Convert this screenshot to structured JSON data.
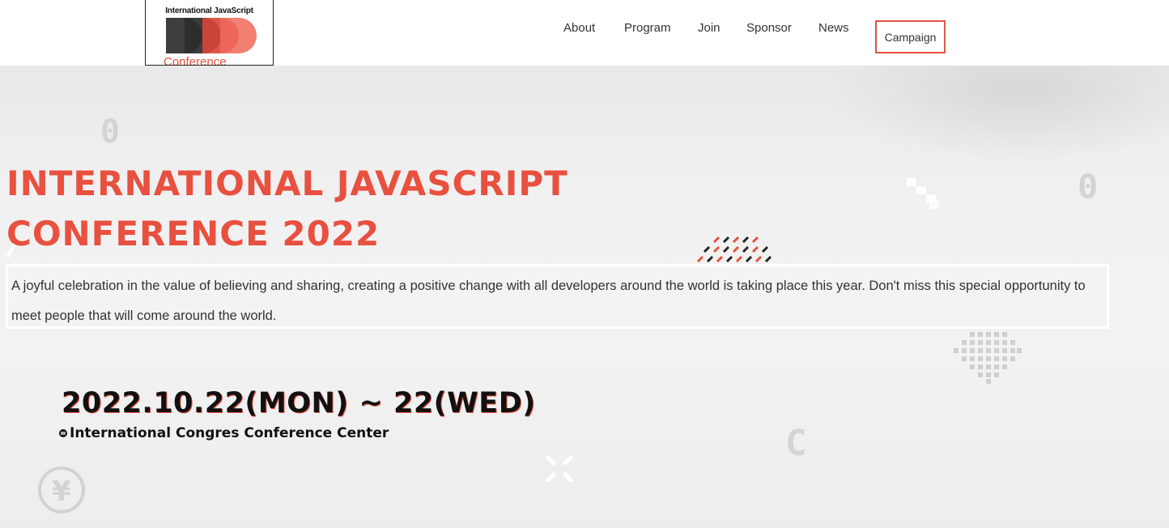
{
  "logo": {
    "title": "International JavaScript",
    "subtitle": "Conference"
  },
  "nav": {
    "items": [
      {
        "label": "About"
      },
      {
        "label": "Program"
      },
      {
        "label": "Join"
      },
      {
        "label": "Sponsor"
      },
      {
        "label": "News"
      }
    ],
    "campaign_label": "Campaign"
  },
  "hero": {
    "headline_line1": "INTERNATIONAL JAVASCRIPT",
    "headline_line2": "CONFERENCE 2022",
    "description": "A joyful celebration in the value of believing and sharing, creating a positive change with all developers around the world is taking place this year. Don't miss this special opportunity to meet people that will come around the world.",
    "date": "2022.10.22(MON) ~ 22(WED)",
    "venue": "International Congres Conference Center"
  },
  "decorations": {
    "glyph_zero": "0",
    "glyph_c": "C",
    "glyph_yen": "¥"
  },
  "colors": {
    "accent": "#e8503f",
    "text": "#333333",
    "header_bg": "#ffffff",
    "hero_bg": "#f0f0f0"
  }
}
